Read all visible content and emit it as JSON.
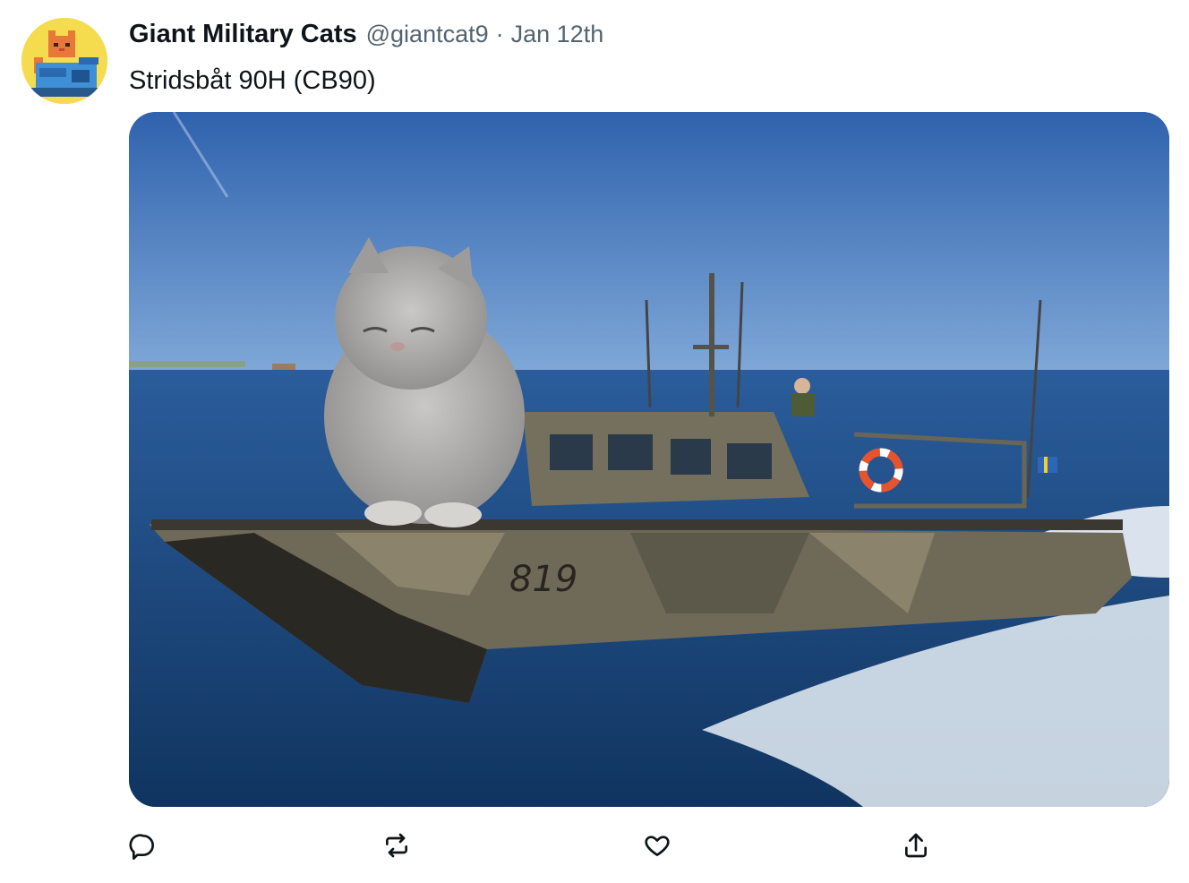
{
  "tweet": {
    "author": {
      "display_name": "Giant Military Cats",
      "handle": "@giantcat9",
      "avatar_icon": "pixel-cat-avatar-icon"
    },
    "separator": "·",
    "date": "Jan 12th",
    "text": "Stridsbåt 90H (CB90)",
    "media": {
      "hull_number": "819",
      "accent_sky": "#3d6fb8",
      "accent_sea": "#22528f"
    },
    "actions": [
      {
        "icon": "reply-icon"
      },
      {
        "icon": "retweet-icon"
      },
      {
        "icon": "like-icon"
      },
      {
        "icon": "share-icon"
      }
    ]
  }
}
